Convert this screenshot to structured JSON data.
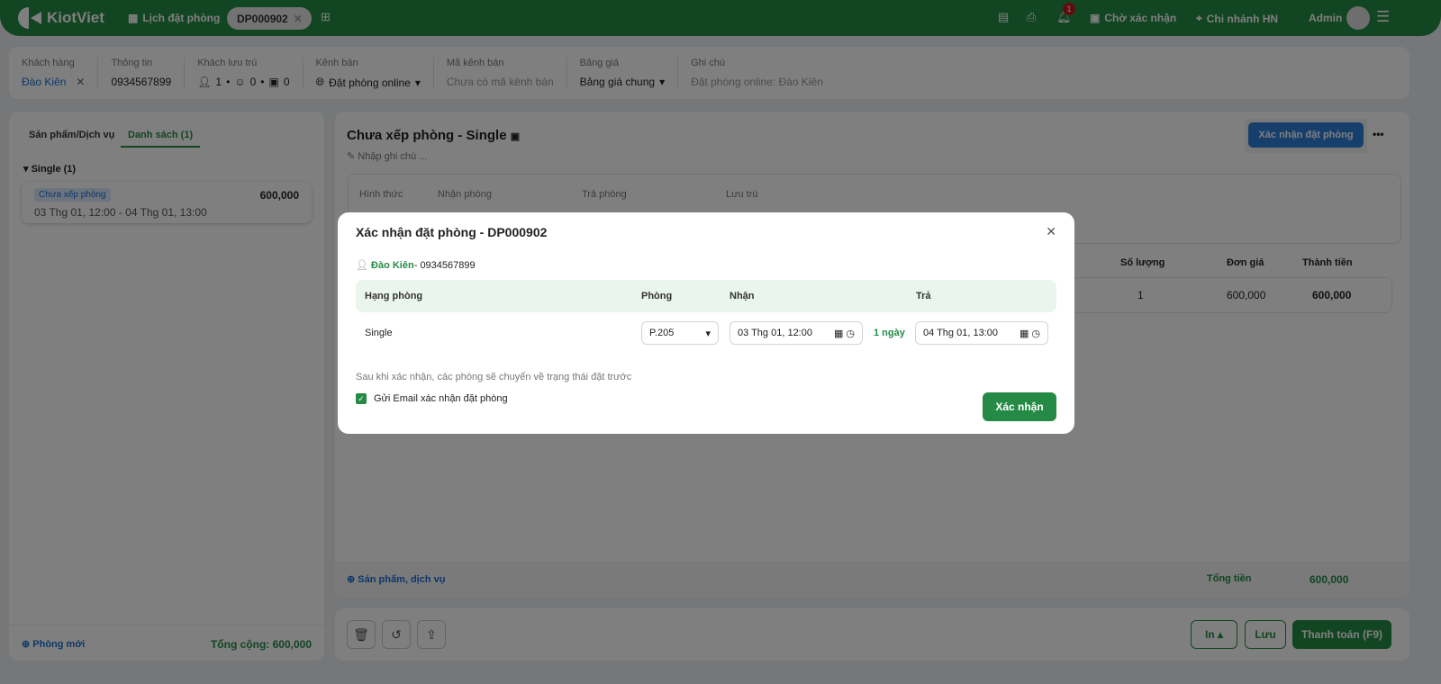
{
  "topbar": {
    "brand": "KiotViet",
    "booking_calendar": "Lịch đặt phòng",
    "active_tab": "DP000902",
    "notif_count": "1",
    "pending": "Chờ xác nhận",
    "branch": "Chi nhánh HN",
    "user": "Admin"
  },
  "info": {
    "customer_label": "Khách hàng",
    "customer": "Đào Kiên",
    "contact_label": "Thông tin",
    "phone": "0934567899",
    "guests_label": "Khách lưu trú",
    "adults": "1",
    "children": "0",
    "ids": "0",
    "channel_label": "Kênh bán",
    "channel": "Đặt phòng online",
    "channel_code_label": "Mã kênh bán",
    "channel_code": "Chưa có mã kênh bán",
    "price_label": "Bảng giá",
    "price": "Bảng giá chung",
    "note_label": "Ghi chú",
    "note": "Đặt phòng online: Đào Kiên"
  },
  "left": {
    "tabs": [
      "Sản phẩm/Dịch vụ",
      "Danh sách (1)"
    ],
    "group": "Single (1)",
    "card": {
      "status": "Chưa xếp phòng",
      "price": "600,000",
      "dates": "03 Thg 01, 12:00 - 04 Thg 01, 13:00"
    },
    "new_room": "Phòng mới",
    "total": "Tổng cộng: 600,000"
  },
  "main": {
    "title": "Chưa xếp phòng - Single",
    "note_placeholder": "Nhập ghi chú ...",
    "confirm_booking": "Xác nhận đặt phòng",
    "fields": [
      "Hình thức",
      "Nhận phòng",
      "Trả phòng",
      "Lưu trú"
    ],
    "cols": [
      "Số lượng",
      "Đơn giá",
      "Thành tiền"
    ],
    "row": {
      "qty": "1",
      "price": "600,000",
      "amount": "600,000"
    },
    "add_service": "Sản phẩm, dịch vụ",
    "total_label": "Tổng tiền",
    "total": "600,000"
  },
  "bottom": {
    "print": "In",
    "save": "Lưu",
    "pay": "Thanh toán (F9)"
  },
  "modal": {
    "title": "Xác nhận đặt phòng - DP000902",
    "customer": "Đào Kiên",
    "phone": "- 0934567899",
    "headers": [
      "Hạng phòng",
      "Phòng",
      "Nhận",
      "Trả"
    ],
    "row": {
      "type": "Single",
      "room": "P.205",
      "checkin": "03 Thg 01, 12:00",
      "duration": "1 ngày",
      "checkout": "04 Thg 01, 13:00"
    },
    "hint": "Sau khi xác nhận, các phòng sẽ chuyển về trạng thái đặt trước",
    "email_label": "Gửi Email xác nhận đặt phòng",
    "email_checked": true,
    "confirm": "Xác nhận"
  }
}
